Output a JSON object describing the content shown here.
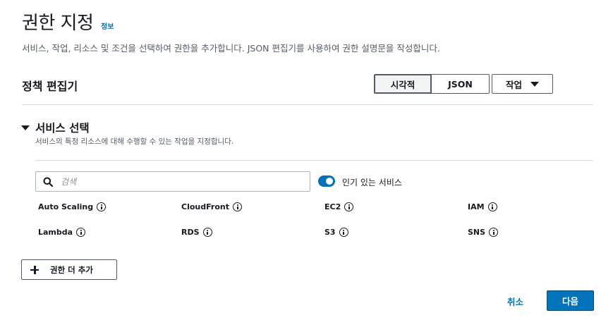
{
  "header": {
    "title": "권한 지정",
    "info_link": "정보",
    "description": "서비스, 작업, 리소스 및 조건을 선택하여 권한을 추가합니다. JSON 편집기를 사용하여 권한 설명문을 작성합니다."
  },
  "policy_editor": {
    "title": "정책 편집기",
    "tabs": [
      {
        "label": "시각적",
        "selected": true
      },
      {
        "label": "JSON",
        "selected": false
      }
    ],
    "actions_label": "작업"
  },
  "service_select": {
    "title": "서비스 선택",
    "description": "서비스의 특정 리소스에 대해 수행할 수 있는 작업을 지정합니다.",
    "search_placeholder": "검색",
    "popular_toggle_label": "인기 있는 서비스",
    "popular_toggle_on": true,
    "services": [
      [
        "Auto Scaling",
        "CloudFront",
        "EC2",
        "IAM"
      ],
      [
        "Lambda",
        "RDS",
        "S3",
        "SNS"
      ]
    ]
  },
  "add_more_label": "권한 더 추가",
  "footer": {
    "cancel_label": "취소",
    "next_label": "다음"
  },
  "colors": {
    "accent": "#0073bb",
    "text": "#16191f",
    "muted": "#545b64",
    "divider": "#d5dbdb"
  }
}
